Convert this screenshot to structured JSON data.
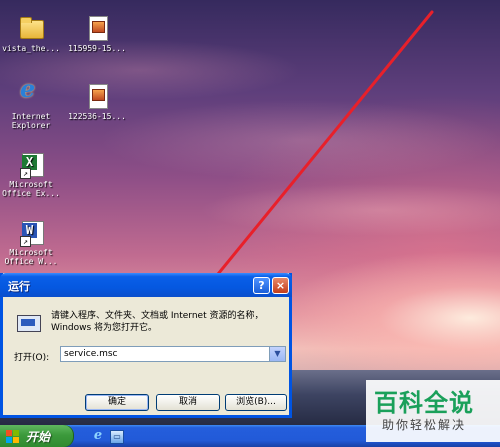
{
  "desktop": {
    "icons": [
      {
        "label": "vista_the...",
        "icon": "folder-icon"
      },
      {
        "label": "115959-15...",
        "icon": "image-file-icon"
      },
      {
        "label": "Internet\nExplorer",
        "icon": "internet-explorer-icon"
      },
      {
        "label": "122536-15...",
        "icon": "image-file-icon"
      },
      {
        "label": "Microsoft\nOffice Ex...",
        "icon": "excel-icon"
      },
      {
        "label": "Microsoft\nOffice W...",
        "icon": "word-icon"
      }
    ]
  },
  "run_dialog": {
    "title": "运行",
    "help_glyph": "?",
    "close_glyph": "×",
    "description": "请键入程序、文件夹、文档或 Internet 资源的名称，Windows 将为您打开它。",
    "open_label": "打开(O):",
    "open_value": "service.msc",
    "ok_label": "确定",
    "cancel_label": "取消",
    "browse_label": "浏览(B)..."
  },
  "taskbar": {
    "start_label": "开始",
    "quick_launch": [
      "internet-explorer-icon",
      "show-desktop-icon"
    ]
  },
  "watermark": {
    "brand": "百科全说",
    "tagline": "助你轻松解决"
  },
  "colors": {
    "title_bar": "#0558e0",
    "start_button": "#3c9a3c",
    "annotation_arrow": "#e8202a",
    "watermark_green": "#1aa05a"
  }
}
